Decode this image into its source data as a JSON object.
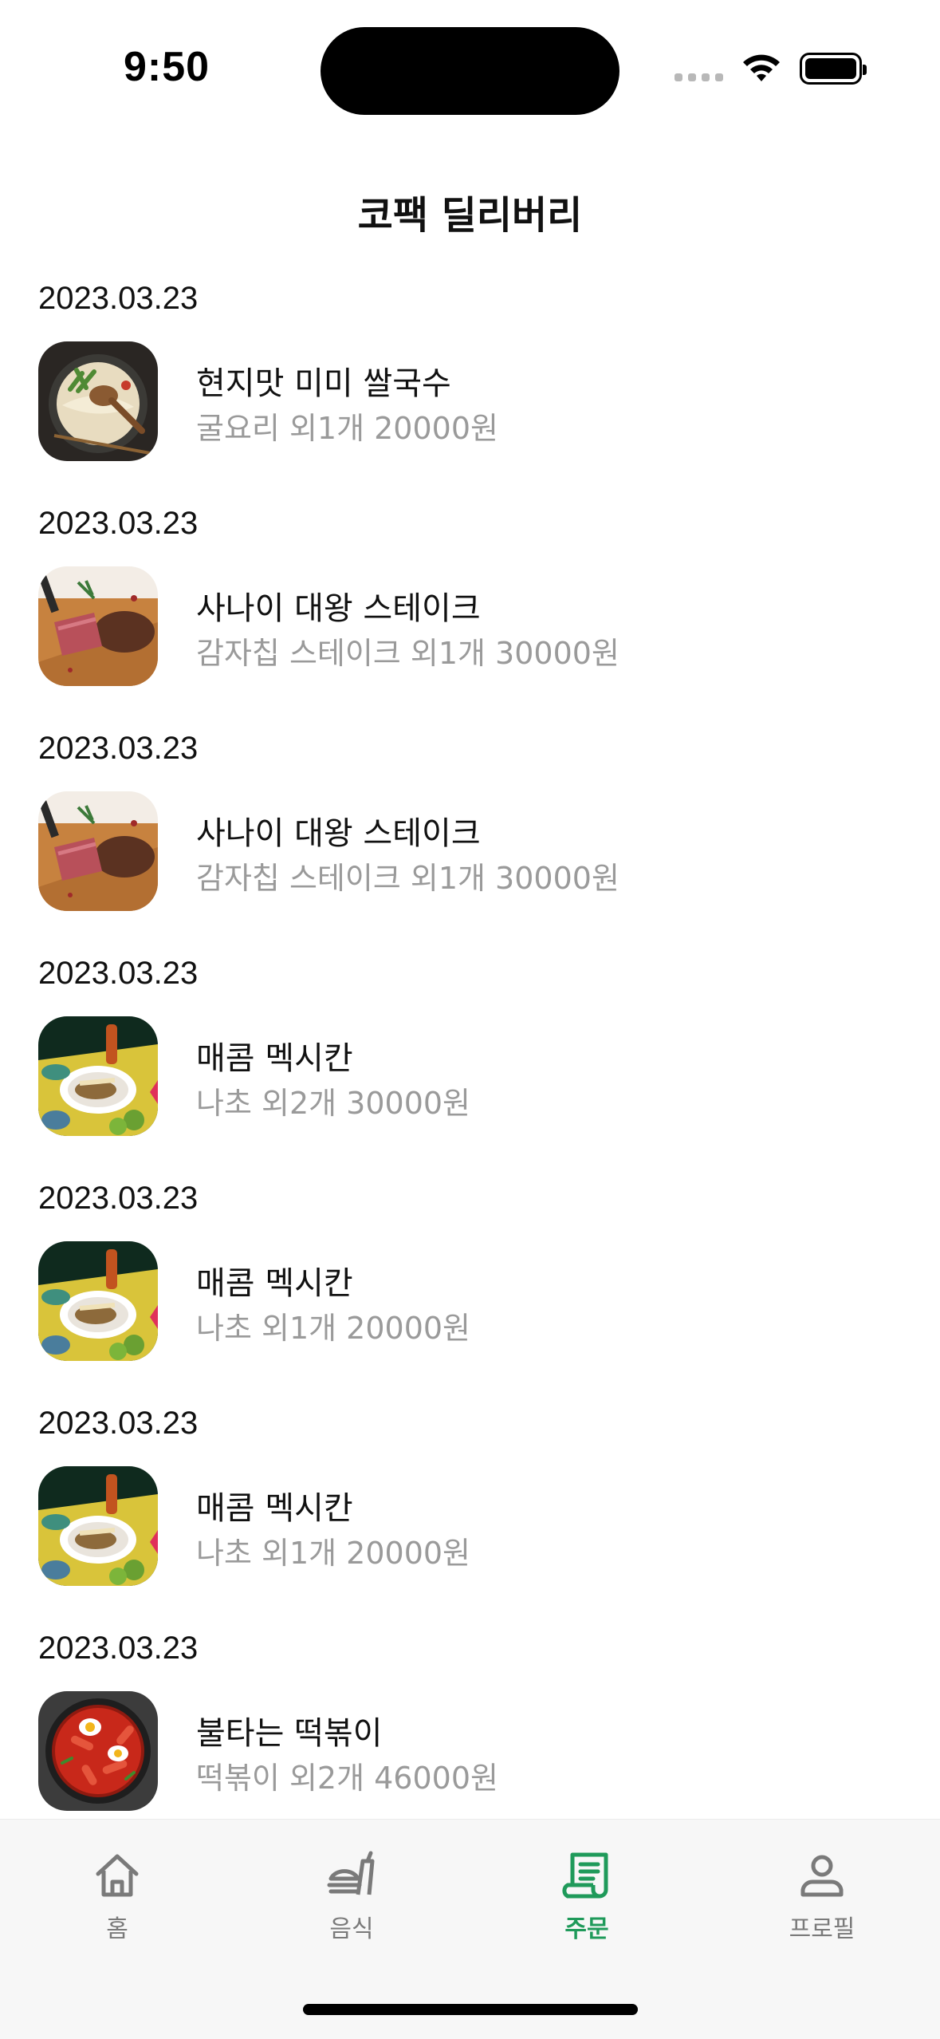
{
  "status_bar": {
    "time": "9:50"
  },
  "header": {
    "title": "코팩 딜리버리"
  },
  "orders": [
    {
      "date": "2023.03.23",
      "name": "현지맛 미미 쌀국수",
      "summary": "굴요리 외1개 20000원",
      "image": "pho-bowl"
    },
    {
      "date": "2023.03.23",
      "name": "사나이 대왕 스테이크",
      "summary": "감자칩 스테이크 외1개 30000원",
      "image": "steak-board"
    },
    {
      "date": "2023.03.23",
      "name": "사나이 대왕 스테이크",
      "summary": "감자칩 스테이크 외1개 30000원",
      "image": "steak-board"
    },
    {
      "date": "2023.03.23",
      "name": "매콤 멕시칸",
      "summary": "나초 외2개 30000원",
      "image": "mexican-plate"
    },
    {
      "date": "2023.03.23",
      "name": "매콤 멕시칸",
      "summary": "나초 외1개 20000원",
      "image": "mexican-plate"
    },
    {
      "date": "2023.03.23",
      "name": "매콤 멕시칸",
      "summary": "나초 외1개 20000원",
      "image": "mexican-plate"
    },
    {
      "date": "2023.03.23",
      "name": "불타는 떡볶이",
      "summary": "떡볶이 외2개 46000원",
      "image": "tteokbokki-pan"
    }
  ],
  "tab_bar": {
    "tabs": [
      {
        "label": "홈",
        "icon": "home-icon",
        "active": false
      },
      {
        "label": "음식",
        "icon": "food-icon",
        "active": false
      },
      {
        "label": "주문",
        "icon": "receipt-icon",
        "active": true
      },
      {
        "label": "프로필",
        "icon": "person-icon",
        "active": false
      }
    ]
  },
  "colors": {
    "accent": "#1f9a5a",
    "inactive": "#7a7a7a",
    "secondary_text": "#9a9a9a",
    "tab_bar_bg": "#f7f7f7"
  }
}
